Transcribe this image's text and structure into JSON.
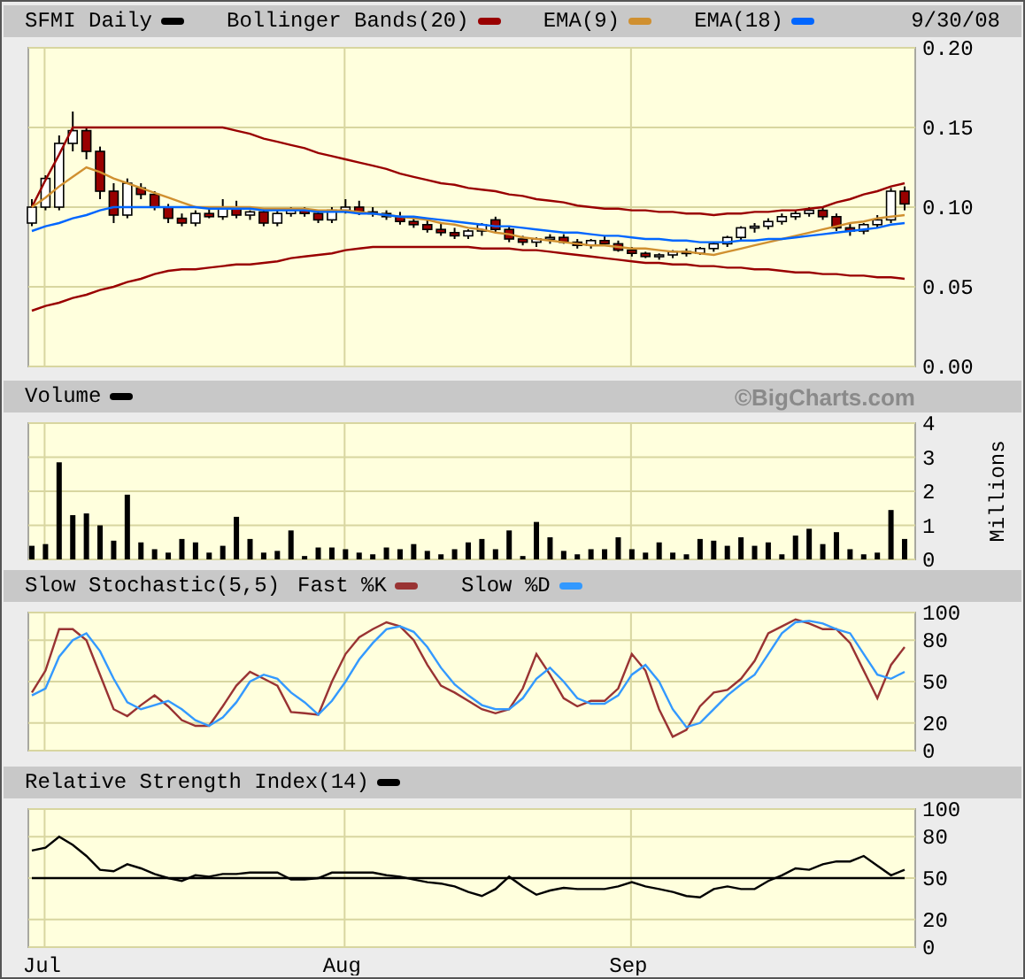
{
  "price_panel": {
    "date": "9/30/08",
    "chart_data": {
      "type": "candlestick",
      "title": "SFMI Daily",
      "grid": true,
      "ylim": [
        0,
        0.2
      ],
      "yticks": [
        {
          "value": 0,
          "label": "0.00"
        },
        {
          "value": 0.05,
          "label": "0.05"
        },
        {
          "value": 0.1,
          "label": "0.10"
        },
        {
          "value": 0.15,
          "label": "0.15"
        },
        {
          "value": 0.2,
          "label": "0.20"
        }
      ],
      "ohlc": [
        [
          0.09,
          0.105,
          0.088,
          0.1
        ],
        [
          0.1,
          0.12,
          0.098,
          0.118
        ],
        [
          0.1,
          0.145,
          0.098,
          0.14
        ],
        [
          0.14,
          0.16,
          0.135,
          0.148
        ],
        [
          0.148,
          0.15,
          0.13,
          0.135
        ],
        [
          0.135,
          0.138,
          0.105,
          0.11
        ],
        [
          0.11,
          0.115,
          0.09,
          0.095
        ],
        [
          0.095,
          0.118,
          0.093,
          0.115
        ],
        [
          0.112,
          0.115,
          0.105,
          0.108
        ],
        [
          0.108,
          0.11,
          0.098,
          0.1
        ],
        [
          0.1,
          0.102,
          0.09,
          0.093
        ],
        [
          0.093,
          0.096,
          0.088,
          0.09
        ],
        [
          0.09,
          0.098,
          0.088,
          0.096
        ],
        [
          0.096,
          0.1,
          0.093,
          0.094
        ],
        [
          0.094,
          0.105,
          0.092,
          0.1
        ],
        [
          0.1,
          0.104,
          0.093,
          0.095
        ],
        [
          0.095,
          0.098,
          0.092,
          0.097
        ],
        [
          0.097,
          0.099,
          0.088,
          0.09
        ],
        [
          0.09,
          0.098,
          0.088,
          0.096
        ],
        [
          0.096,
          0.1,
          0.094,
          0.098
        ],
        [
          0.098,
          0.1,
          0.094,
          0.096
        ],
        [
          0.096,
          0.098,
          0.09,
          0.092
        ],
        [
          0.092,
          0.1,
          0.09,
          0.098
        ],
        [
          0.098,
          0.105,
          0.096,
          0.1
        ],
        [
          0.1,
          0.104,
          0.095,
          0.097
        ],
        [
          0.097,
          0.1,
          0.094,
          0.096
        ],
        [
          0.096,
          0.098,
          0.092,
          0.094
        ],
        [
          0.094,
          0.097,
          0.089,
          0.091
        ],
        [
          0.091,
          0.094,
          0.087,
          0.089
        ],
        [
          0.089,
          0.092,
          0.084,
          0.086
        ],
        [
          0.086,
          0.09,
          0.082,
          0.084
        ],
        [
          0.084,
          0.087,
          0.08,
          0.082
        ],
        [
          0.082,
          0.086,
          0.08,
          0.085
        ],
        [
          0.085,
          0.09,
          0.082,
          0.089
        ],
        [
          0.092,
          0.094,
          0.084,
          0.086
        ],
        [
          0.086,
          0.088,
          0.078,
          0.08
        ],
        [
          0.08,
          0.082,
          0.076,
          0.078
        ],
        [
          0.078,
          0.081,
          0.075,
          0.08
        ],
        [
          0.08,
          0.083,
          0.077,
          0.081
        ],
        [
          0.081,
          0.083,
          0.077,
          0.078
        ],
        [
          0.078,
          0.08,
          0.074,
          0.076
        ],
        [
          0.076,
          0.08,
          0.074,
          0.079
        ],
        [
          0.079,
          0.082,
          0.076,
          0.077
        ],
        [
          0.077,
          0.079,
          0.072,
          0.073
        ],
        [
          0.073,
          0.075,
          0.069,
          0.071
        ],
        [
          0.071,
          0.072,
          0.068,
          0.069
        ],
        [
          0.069,
          0.071,
          0.067,
          0.07
        ],
        [
          0.07,
          0.073,
          0.068,
          0.072
        ],
        [
          0.072,
          0.074,
          0.069,
          0.071
        ],
        [
          0.071,
          0.075,
          0.07,
          0.074
        ],
        [
          0.074,
          0.078,
          0.072,
          0.077
        ],
        [
          0.077,
          0.082,
          0.075,
          0.081
        ],
        [
          0.081,
          0.088,
          0.079,
          0.087
        ],
        [
          0.087,
          0.09,
          0.084,
          0.088
        ],
        [
          0.088,
          0.093,
          0.086,
          0.091
        ],
        [
          0.091,
          0.096,
          0.089,
          0.094
        ],
        [
          0.094,
          0.098,
          0.092,
          0.096
        ],
        [
          0.096,
          0.1,
          0.094,
          0.098
        ],
        [
          0.098,
          0.1,
          0.092,
          0.094
        ],
        [
          0.094,
          0.096,
          0.085,
          0.087
        ],
        [
          0.087,
          0.09,
          0.082,
          0.085
        ],
        [
          0.085,
          0.09,
          0.083,
          0.089
        ],
        [
          0.089,
          0.095,
          0.087,
          0.092
        ],
        [
          0.092,
          0.112,
          0.09,
          0.11
        ],
        [
          0.11,
          0.113,
          0.098,
          0.102
        ]
      ]
    },
    "indicators": {
      "chart_data": {
        "type": "line",
        "ylim": [
          0,
          0.2
        ],
        "series": [
          {
            "name": "Bollinger Bands(20)",
            "color": "#990000",
            "values": [
              0.1,
              0.117,
              0.133,
              0.15,
              0.15,
              0.15,
              0.15,
              0.15,
              0.15,
              0.15,
              0.15,
              0.15,
              0.15,
              0.15,
              0.15,
              0.148,
              0.146,
              0.143,
              0.141,
              0.139,
              0.137,
              0.134,
              0.132,
              0.13,
              0.128,
              0.126,
              0.124,
              0.121,
              0.119,
              0.117,
              0.115,
              0.114,
              0.112,
              0.111,
              0.11,
              0.108,
              0.107,
              0.105,
              0.104,
              0.103,
              0.101,
              0.1,
              0.099,
              0.099,
              0.098,
              0.098,
              0.097,
              0.097,
              0.096,
              0.096,
              0.095,
              0.096,
              0.096,
              0.097,
              0.097,
              0.098,
              0.098,
              0.099,
              0.1,
              0.103,
              0.105,
              0.108,
              0.11,
              0.113,
              0.115
            ]
          },
          {
            "color": "#990000",
            "values": [
              0.035,
              0.038,
              0.04,
              0.043,
              0.045,
              0.048,
              0.05,
              0.053,
              0.055,
              0.058,
              0.06,
              0.061,
              0.061,
              0.062,
              0.063,
              0.064,
              0.064,
              0.065,
              0.066,
              0.068,
              0.069,
              0.07,
              0.071,
              0.073,
              0.074,
              0.075,
              0.075,
              0.075,
              0.075,
              0.075,
              0.075,
              0.075,
              0.075,
              0.074,
              0.074,
              0.074,
              0.073,
              0.073,
              0.072,
              0.071,
              0.07,
              0.069,
              0.068,
              0.067,
              0.066,
              0.065,
              0.065,
              0.064,
              0.064,
              0.063,
              0.063,
              0.062,
              0.062,
              0.061,
              0.061,
              0.06,
              0.059,
              0.059,
              0.058,
              0.058,
              0.057,
              0.057,
              0.056,
              0.056,
              0.055
            ]
          },
          {
            "name": "EMA(9)",
            "color": "#d09030",
            "values": [
              0.1,
              0.106,
              0.113,
              0.119,
              0.125,
              0.122,
              0.118,
              0.115,
              0.112,
              0.109,
              0.106,
              0.103,
              0.1,
              0.1,
              0.1,
              0.1,
              0.1,
              0.099,
              0.099,
              0.099,
              0.099,
              0.098,
              0.098,
              0.098,
              0.097,
              0.096,
              0.095,
              0.094,
              0.093,
              0.092,
              0.09,
              0.089,
              0.087,
              0.086,
              0.084,
              0.083,
              0.081,
              0.08,
              0.079,
              0.078,
              0.077,
              0.076,
              0.076,
              0.075,
              0.074,
              0.074,
              0.073,
              0.072,
              0.072,
              0.071,
              0.07,
              0.072,
              0.074,
              0.076,
              0.078,
              0.08,
              0.082,
              0.084,
              0.086,
              0.088,
              0.09,
              0.091,
              0.093,
              0.094,
              0.095
            ]
          },
          {
            "name": "EMA(18)",
            "color": "#0066ff",
            "values": [
              0.085,
              0.088,
              0.09,
              0.093,
              0.095,
              0.098,
              0.1,
              0.1,
              0.1,
              0.1,
              0.1,
              0.1,
              0.1,
              0.099,
              0.099,
              0.099,
              0.099,
              0.098,
              0.098,
              0.098,
              0.098,
              0.097,
              0.097,
              0.097,
              0.096,
              0.096,
              0.095,
              0.094,
              0.094,
              0.093,
              0.092,
              0.091,
              0.09,
              0.089,
              0.088,
              0.088,
              0.087,
              0.086,
              0.085,
              0.084,
              0.084,
              0.083,
              0.082,
              0.082,
              0.081,
              0.08,
              0.08,
              0.079,
              0.079,
              0.078,
              0.078,
              0.078,
              0.079,
              0.079,
              0.08,
              0.08,
              0.081,
              0.082,
              0.083,
              0.084,
              0.085,
              0.086,
              0.087,
              0.089,
              0.09
            ]
          }
        ]
      }
    }
  },
  "volume_panel": {
    "credit": "©BigCharts.com",
    "chart_data": {
      "type": "bar",
      "grid": true,
      "ylabel": "Millions",
      "ylim": [
        0,
        4
      ],
      "yticks": [
        0,
        1,
        2,
        3,
        4
      ],
      "series": [
        {
          "name": "Volume",
          "color": "#000000",
          "values": [
            0.4,
            0.45,
            2.85,
            1.3,
            1.35,
            1.0,
            0.55,
            1.9,
            0.5,
            0.3,
            0.2,
            0.6,
            0.5,
            0.2,
            0.4,
            1.25,
            0.6,
            0.2,
            0.25,
            0.85,
            0.1,
            0.35,
            0.35,
            0.3,
            0.2,
            0.15,
            0.35,
            0.3,
            0.45,
            0.25,
            0.15,
            0.3,
            0.5,
            0.6,
            0.3,
            0.85,
            0.1,
            1.1,
            0.65,
            0.25,
            0.15,
            0.3,
            0.3,
            0.65,
            0.3,
            0.2,
            0.5,
            0.2,
            0.15,
            0.6,
            0.55,
            0.4,
            0.65,
            0.4,
            0.5,
            0.15,
            0.7,
            0.9,
            0.45,
            0.8,
            0.3,
            0.15,
            0.2,
            1.45,
            0.6
          ]
        }
      ]
    }
  },
  "stochastic_panel": {
    "chart_data": {
      "type": "line",
      "title": "Slow Stochastic(5,5)",
      "grid": true,
      "ylim": [
        0,
        100
      ],
      "yticks": [
        0,
        20,
        50,
        80,
        100
      ],
      "series": [
        {
          "name": "Fast %K",
          "color": "#993333",
          "values": [
            42,
            58,
            88,
            88,
            80,
            55,
            30,
            25,
            33,
            40,
            32,
            22,
            18,
            18,
            32,
            47,
            57,
            52,
            47,
            28,
            27,
            26,
            50,
            70,
            82,
            88,
            93,
            90,
            80,
            62,
            47,
            42,
            36,
            30,
            27,
            30,
            45,
            70,
            55,
            38,
            32,
            36,
            36,
            45,
            70,
            58,
            30,
            10,
            15,
            32,
            42,
            44,
            52,
            65,
            85,
            90,
            95,
            92,
            88,
            88,
            78,
            58,
            38,
            62,
            75
          ]
        },
        {
          "name": "Slow %D",
          "color": "#3399ff",
          "values": [
            40,
            45,
            68,
            80,
            85,
            72,
            52,
            35,
            30,
            33,
            36,
            30,
            22,
            18,
            24,
            35,
            50,
            55,
            52,
            42,
            35,
            26,
            36,
            50,
            66,
            78,
            88,
            90,
            86,
            75,
            60,
            48,
            40,
            33,
            30,
            30,
            38,
            52,
            60,
            50,
            38,
            34,
            34,
            40,
            55,
            62,
            50,
            30,
            17,
            20,
            30,
            40,
            48,
            55,
            70,
            85,
            93,
            94,
            92,
            88,
            85,
            70,
            55,
            52,
            57
          ]
        }
      ]
    }
  },
  "rsi_panel": {
    "month_labels": [
      "Jul",
      "Aug",
      "Sep"
    ],
    "chart_data": {
      "type": "line",
      "grid": true,
      "ylim": [
        0,
        100
      ],
      "yticks": [
        0,
        20,
        50,
        80,
        100
      ],
      "series": [
        {
          "color": "#000000",
          "values": [
            50,
            50,
            50,
            50,
            50,
            50,
            50,
            50,
            50,
            50,
            50,
            50,
            50,
            50,
            50,
            50,
            50,
            50,
            50,
            50,
            50,
            50,
            50,
            50,
            50,
            50,
            50,
            50,
            50,
            50,
            50,
            50,
            50,
            50,
            50,
            50,
            50,
            50,
            50,
            50,
            50,
            50,
            50,
            50,
            50,
            50,
            50,
            50,
            50,
            50,
            50,
            50,
            50,
            50,
            50,
            50,
            50,
            50,
            50,
            50,
            50,
            50,
            50,
            50,
            50
          ]
        },
        {
          "name": "Relative Strength Index(14)",
          "color": "#000000",
          "values": [
            70,
            72,
            80,
            74,
            66,
            56,
            55,
            60,
            57,
            53,
            50,
            48,
            52,
            51,
            53,
            53,
            54,
            54,
            54,
            49,
            49,
            50,
            54,
            54,
            54,
            54,
            52,
            51,
            49,
            47,
            46,
            44,
            40,
            37,
            42,
            51,
            44,
            38,
            41,
            43,
            42,
            42,
            42,
            44,
            47,
            44,
            42,
            40,
            37,
            36,
            42,
            44,
            42,
            42,
            48,
            52,
            57,
            56,
            60,
            62,
            62,
            66,
            59,
            52,
            56
          ]
        }
      ]
    }
  }
}
